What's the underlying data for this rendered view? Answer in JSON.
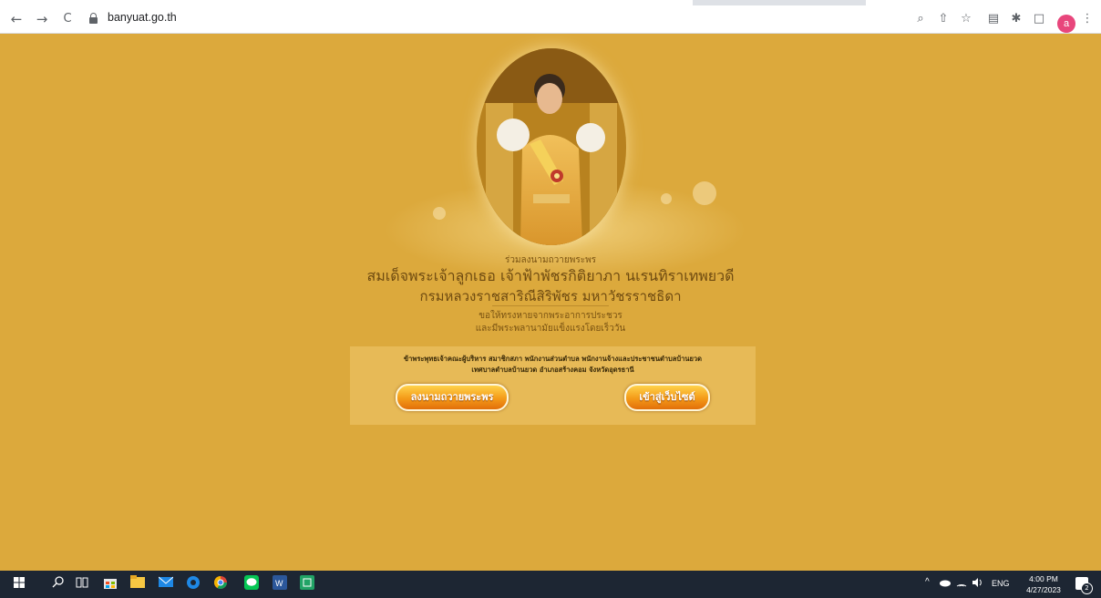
{
  "browser": {
    "url": "banyuat.go.th",
    "nav_icons": {
      "back": "←",
      "forward": "→",
      "reload": "C"
    },
    "toolbar_icons": {
      "zoom": "⌕",
      "share": "⇧",
      "bookmark": "☆",
      "reading": "▤",
      "extensions": "✱",
      "sidebar": "□",
      "menu": "⋮"
    },
    "profile_initial": "a"
  },
  "page": {
    "background_color": "#dca93c",
    "heading_small": "ร่วมลงนามถวายพระพร",
    "heading_line1": "สมเด็จพระเจ้าลูกเธอ เจ้าฟ้าพัชรกิติยาภา นเรนทิราเทพยวดี",
    "heading_line2": "กรมหลวงราชสาริณีสิริพัชร มหาวัชรราชธิดา",
    "wish_line1": "ขอให้ทรงหายจากพระอาการประชวร",
    "wish_line2": "และมีพระพลานามัยแข็งแรงโดยเร็ววัน",
    "panel_text_line1": "ข้าพระพุทธเจ้าคณะผู้บริหาร สมาชิกสภา พนักงานส่วนตำบล พนักงานจ้างและประชาชนตำบลบ้านยวด",
    "panel_text_line2": "เทศบาลตำบลบ้านยวด อำเภอสร้างคอม จังหวัดอุดรธานี",
    "sign_button": "ลงนามถวายพระพร",
    "enter_button": "เข้าสู่เว็บไซต์"
  },
  "taskbar": {
    "tray_lang": "ENG",
    "time": "4:00 PM",
    "date": "4/27/2023",
    "notification_count": "2"
  }
}
